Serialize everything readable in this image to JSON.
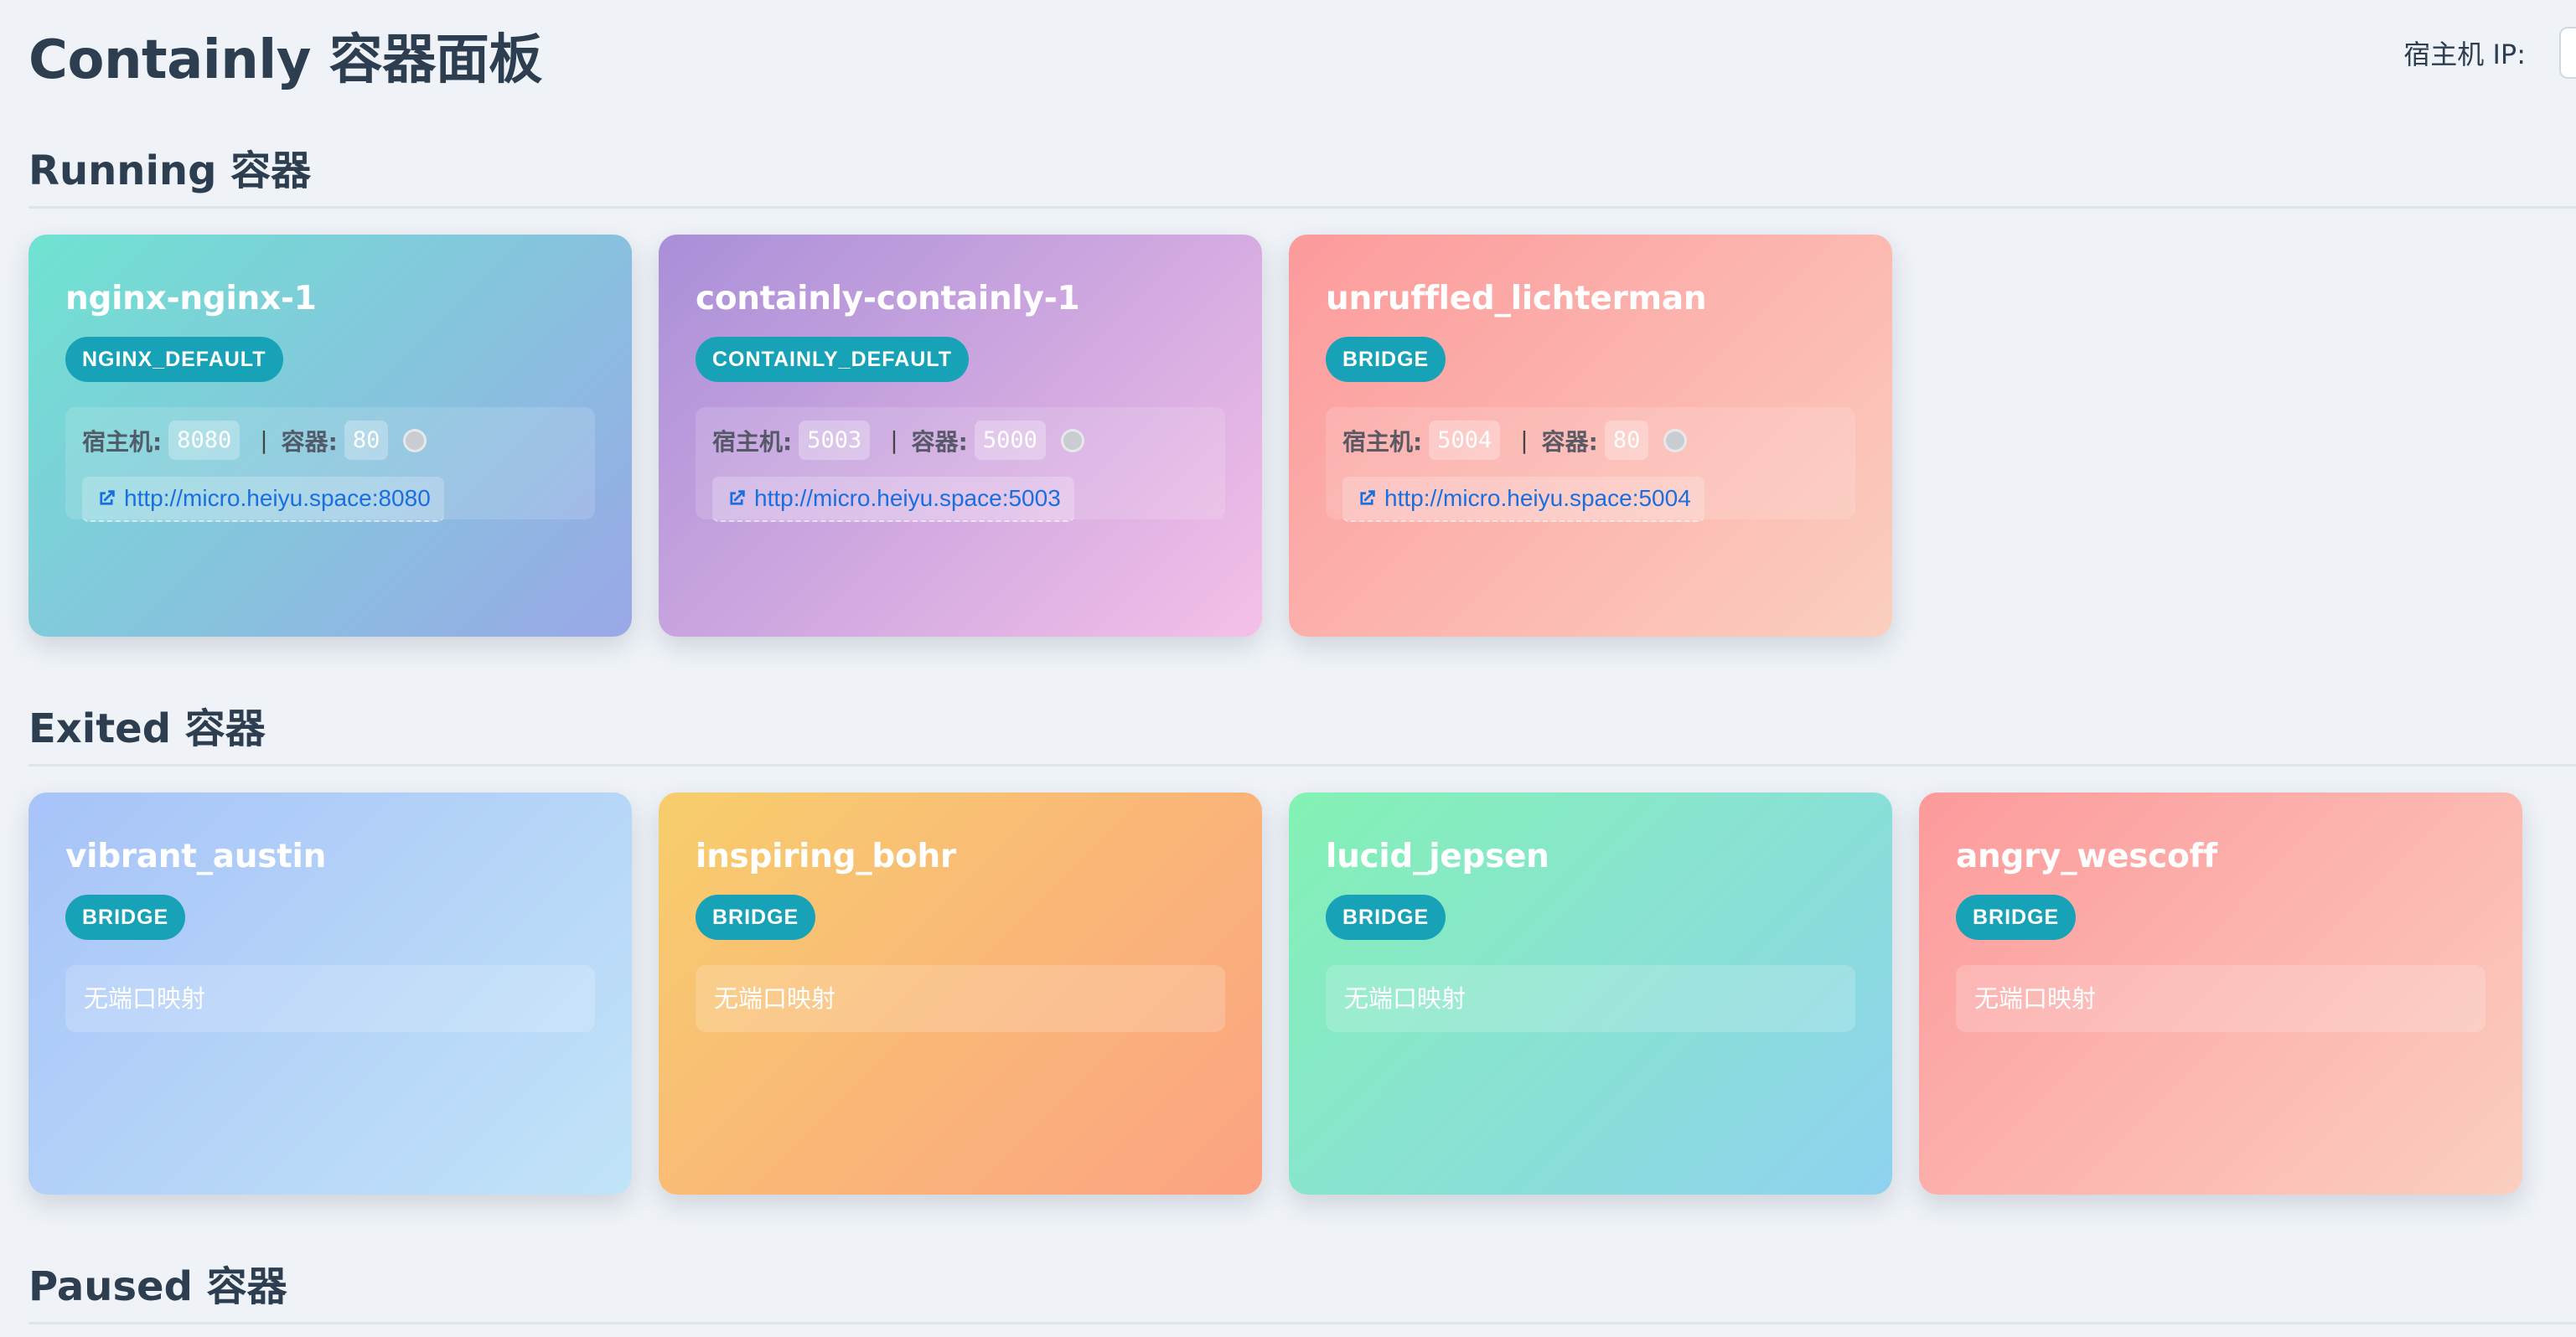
{
  "header": {
    "title": "Containly 容器面板",
    "host_ip_label": "宿主机 IP:",
    "host_ip_value": ""
  },
  "sections": [
    {
      "title": "Running 容器"
    },
    {
      "title": "Exited 容器"
    },
    {
      "title": "Paused 容器"
    }
  ],
  "running": [
    {
      "name": "nginx-nginx-1",
      "network": "NGINX_DEFAULT",
      "host_label": "宿主机:",
      "host_port": "8080",
      "sep": "|",
      "container_label": "容器:",
      "container_port": "80",
      "url": "http://micro.heiyu.space:8080",
      "gradient": [
        "#6fe3d1",
        "#9aa8e8"
      ]
    },
    {
      "name": "containly-containly-1",
      "network": "CONTAINLY_DEFAULT",
      "host_label": "宿主机:",
      "host_port": "5003",
      "sep": "|",
      "container_label": "容器:",
      "container_port": "5000",
      "url": "http://micro.heiyu.space:5003",
      "gradient": [
        "#a98fd8",
        "#f4c0e8"
      ]
    },
    {
      "name": "unruffled_lichterman",
      "network": "BRIDGE",
      "host_label": "宿主机:",
      "host_port": "5004",
      "sep": "|",
      "container_label": "容器:",
      "container_port": "80",
      "url": "http://micro.heiyu.space:5004",
      "gradient": [
        "#fd9a9c",
        "#fbcfc0"
      ]
    }
  ],
  "exited": [
    {
      "name": "vibrant_austin",
      "network": "BRIDGE",
      "no_ports": "无端口映射",
      "gradient": [
        "#a7c3f8",
        "#c2e4f8"
      ]
    },
    {
      "name": "inspiring_bohr",
      "network": "BRIDGE",
      "no_ports": "无端口映射",
      "gradient": [
        "#f7ce6c",
        "#fca283"
      ]
    },
    {
      "name": "lucid_jepsen",
      "network": "BRIDGE",
      "no_ports": "无端口映射",
      "gradient": [
        "#83f2b4",
        "#8fd2f0"
      ]
    },
    {
      "name": "angry_wescoff",
      "network": "BRIDGE",
      "no_ports": "无端口映射",
      "gradient": [
        "#fd9a9c",
        "#fbcfc0"
      ]
    }
  ],
  "icons": {
    "link": "external-link-icon",
    "status": "status-dot"
  }
}
